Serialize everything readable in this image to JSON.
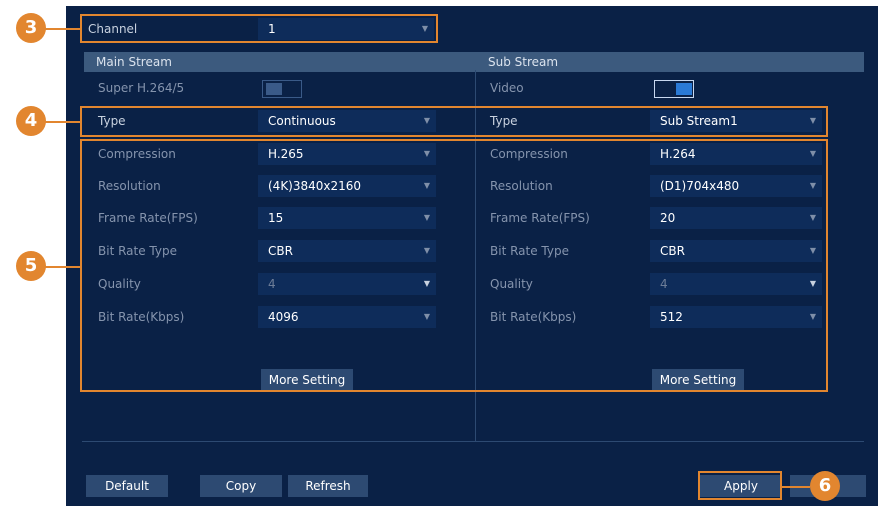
{
  "channel": {
    "label": "Channel",
    "value": "1"
  },
  "main_stream": {
    "header": "Main Stream",
    "super_label": "Super H.264/5",
    "type_label": "Type",
    "type_value": "Continuous",
    "fields": [
      {
        "label": "Compression",
        "value": "H.265"
      },
      {
        "label": "Resolution",
        "value": "(4K)3840x2160"
      },
      {
        "label": "Frame Rate(FPS)",
        "value": "15"
      },
      {
        "label": "Bit Rate Type",
        "value": "CBR"
      },
      {
        "label": "Quality",
        "value": "4"
      },
      {
        "label": "Bit Rate(Kbps)",
        "value": "4096"
      }
    ],
    "more_setting": "More Setting"
  },
  "sub_stream": {
    "header": "Sub Stream",
    "video_label": "Video",
    "type_label": "Type",
    "type_value": "Sub Stream1",
    "fields": [
      {
        "label": "Compression",
        "value": "H.264"
      },
      {
        "label": "Resolution",
        "value": "(D1)704x480"
      },
      {
        "label": "Frame Rate(FPS)",
        "value": "20"
      },
      {
        "label": "Bit Rate Type",
        "value": "CBR"
      },
      {
        "label": "Quality",
        "value": "4"
      },
      {
        "label": "Bit Rate(Kbps)",
        "value": "512"
      }
    ],
    "more_setting": "More Setting"
  },
  "buttons": {
    "default": "Default",
    "copy": "Copy",
    "refresh": "Refresh",
    "apply": "Apply"
  },
  "callouts": [
    "3",
    "4",
    "5",
    "6"
  ],
  "colors": {
    "panel_bg": "#0a2146",
    "field_bg": "#0e2c5a",
    "header_bg": "#3c5a7e",
    "highlight": "#e2862f",
    "toggle_on": "#2a7ad6"
  },
  "icons": {
    "dropdown": "chevron-down-icon"
  }
}
